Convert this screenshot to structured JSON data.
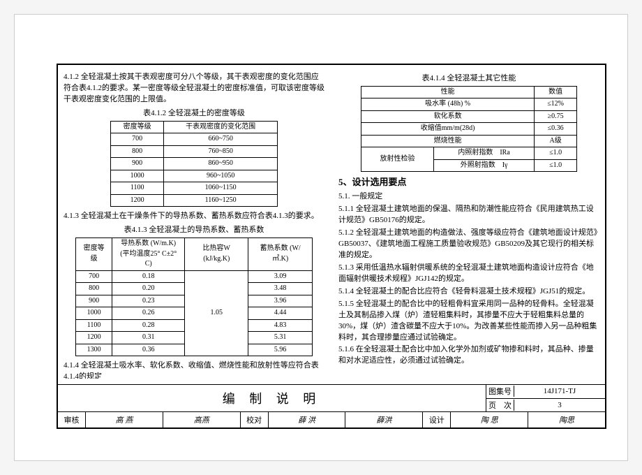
{
  "left": {
    "p412": "4.1.2 全轻混凝土按其干表观密度可分八个等级，其干表观密度的变化范围应符合表4.1.2的要求。某一密度等级全轻混凝土的密度标准值，可取该密度等级干表观密度变化范围的上限值。",
    "t412_title": "表4.1.2 全轻混凝土的密度等级",
    "t412_headers": [
      "密度等级",
      "干表观密度的变化范围"
    ],
    "t412_rows": [
      [
        "700",
        "660~750"
      ],
      [
        "800",
        "760~850"
      ],
      [
        "900",
        "860~950"
      ],
      [
        "1000",
        "960~1050"
      ],
      [
        "1100",
        "1060~1150"
      ],
      [
        "1200",
        "1160~1250"
      ]
    ],
    "p413": "4.1.3 全轻混凝土在干燥条件下的导热系数、蓄热系数应符合表4.1.3的要求。",
    "t413_title": "表4.1.3 全轻混凝土的导热系数、蓄热系数",
    "t413_headers": [
      "密度等级",
      "导热系数 (W/m.K)\n(平均温度25° C±2° C)",
      "比热容W (kJ/kg.K)",
      "蓄热系数 (W/㎡.K)"
    ],
    "t413_rows": [
      [
        "700",
        "0.18",
        "1.05",
        "3.09"
      ],
      [
        "800",
        "0.20",
        "",
        "3.48"
      ],
      [
        "900",
        "0.23",
        "",
        "3.96"
      ],
      [
        "1000",
        "0.26",
        "",
        "4.44"
      ],
      [
        "1100",
        "0.28",
        "",
        "4.83"
      ],
      [
        "1200",
        "0.31",
        "",
        "5.31"
      ],
      [
        "1300",
        "0.36",
        "",
        "5.96"
      ]
    ],
    "p414": "4.1.4 全轻混凝土吸水率、软化系数、收缩值、燃烧性能和放射性等应符合表4.1.4的规定"
  },
  "right": {
    "t414_title": "表4.1.4 全轻混凝土其它性能",
    "t414_headers": [
      "性能",
      "数值"
    ],
    "t414_rows": [
      [
        "吸水率 (48h) %",
        "≤12%"
      ],
      [
        "软化系数",
        "≥0.75"
      ],
      [
        "收缩值mm/m(28d)",
        "≤0.36"
      ],
      [
        "燃烧性能",
        "A级"
      ]
    ],
    "t414_rad_label": "放射性检验",
    "t414_rad_rows": [
      [
        "内照射指数　IRa",
        "≤1.0"
      ],
      [
        "外照射指数　Iγ",
        "≤1.0"
      ]
    ],
    "sec5": "5、设计选用要点",
    "p51": "5.1. 一般规定",
    "p511": "5.1.1 全轻混凝土建筑地面的保温、隔热和防潮性能应符合《民用建筑热工设计规范》GB50176的规定。",
    "p512": "5.1.2 全轻混凝土建筑地面的构造做法、强度等级应符合《建筑地面设计规范》GB50037、《建筑地面工程施工质量验收规范》GB50209及其它现行的相关标准的规定。",
    "p513": "5.1.3 采用低温热水辐射供暖系统的全轻混凝土建筑地面构造设计应符合《地面辐射供暖技术规程》JGJ142的规定。",
    "p514": "5.1.4 全轻混凝土的配合比应符合《轻骨料混凝土技术规程》JGJ51的规定。",
    "p515": "5.1.5 全轻混凝土的配合比中的轻粗骨料宜采用同一品种的轻骨料。全轻混凝土及其制品掺入煤（炉）渣轻粗集料时，其掺量不应大于轻粗集料总量的30%，煤（炉）渣含碳量不应大于10%。为改善某些性能而掺入另一品种粗集料时，其合理掺量应通过试验确定。",
    "p516": "5.1.6 在全轻混凝土配合比中加入化学外加剂或矿物掺和料时，其品种、掺量和对水泥适应性，必须通过试验确定。"
  },
  "titleblock": {
    "title": "编 制 说 明",
    "series_label": "图集号",
    "series_val": "14J171-TJ",
    "page_label": "页　次",
    "page_val": "3",
    "row2": [
      {
        "label": "审核",
        "sig": "高 燕"
      },
      {
        "sig": "高燕"
      },
      {
        "label": "校对",
        "sig": "薛 洪"
      },
      {
        "sig": "薛洪"
      },
      {
        "label": "设计",
        "sig": "陶 思"
      },
      {
        "sig": "陶思"
      }
    ]
  }
}
